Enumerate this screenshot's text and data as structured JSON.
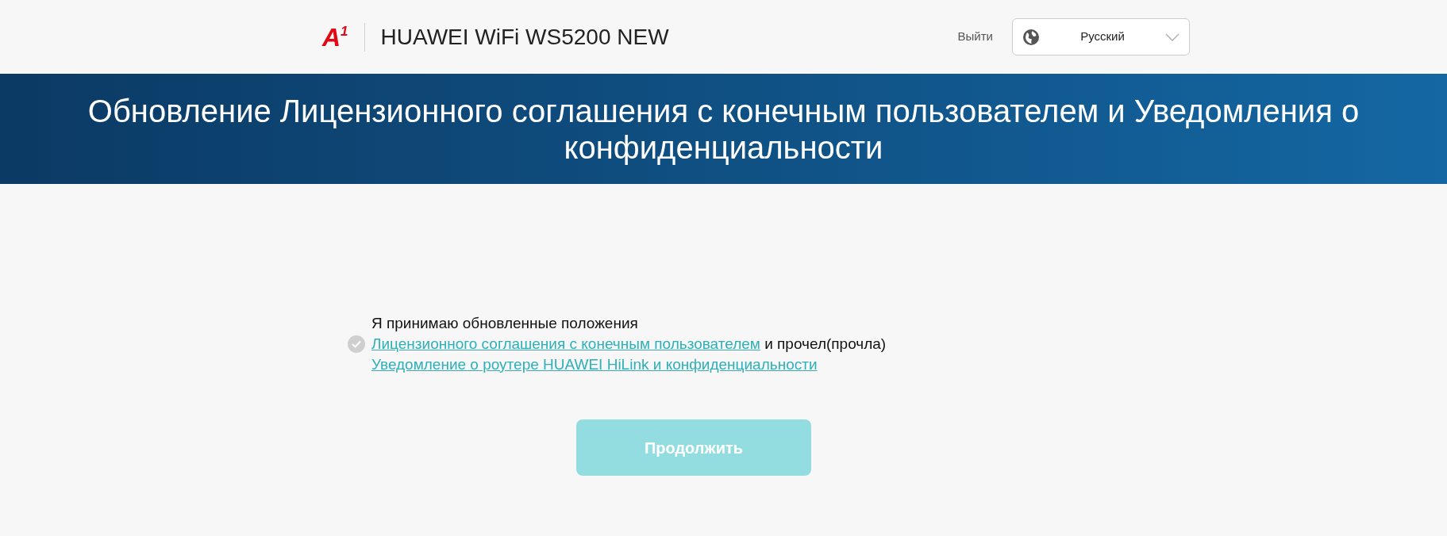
{
  "header": {
    "logo": {
      "letter": "A",
      "sup": "1"
    },
    "product": "HUAWEI WiFi WS5200 NEW",
    "logout": "Выйти",
    "language": "Русский"
  },
  "banner": {
    "title": "Обновление Лицензионного соглашения с конечным пользователем и Уведомления о конфиденциальности"
  },
  "agreement": {
    "checked": false,
    "parts": [
      {
        "kind": "text",
        "text": "Я принимаю обновленные положения"
      },
      {
        "kind": "link",
        "text": "Лицензионного соглашения с конечным пользователем"
      },
      {
        "kind": "text",
        "text": "и прочел(прочла)"
      },
      {
        "kind": "link",
        "text": "Уведомление о роутере HUAWEI HiLink и конфиденциальности"
      }
    ]
  },
  "continue_button": {
    "label": "Продолжить",
    "disabled": true
  }
}
